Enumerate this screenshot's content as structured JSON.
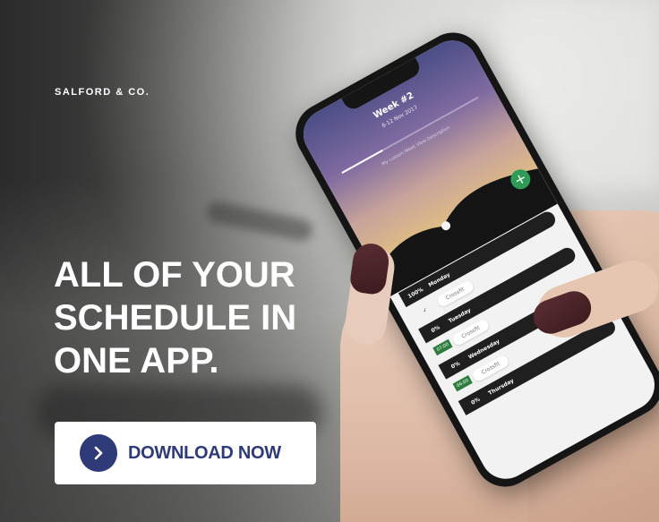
{
  "brand": "SALFORD & CO.",
  "headline": {
    "line1": "ALL OF YOUR",
    "line2": "SCHEDULE IN",
    "line3": "ONE APP."
  },
  "cta": {
    "label": "DOWNLOAD NOW",
    "icon": "chevron-right-icon"
  },
  "phone_screen": {
    "title": "Week #2",
    "date_range": "6-12 Nov 2017",
    "description": "My custom Week View Description",
    "days": [
      {
        "percent": "100%",
        "day": "Monday",
        "check": "✓",
        "time": "",
        "activity": "Crossfit"
      },
      {
        "percent": "0%",
        "day": "Tuesday",
        "check": "",
        "time": "07:00",
        "activity": "Crossfit"
      },
      {
        "percent": "0%",
        "day": "Wednesday",
        "check": "",
        "time": "06:00",
        "activity": "Crossfit"
      },
      {
        "percent": "0%",
        "day": "Thursday",
        "check": "",
        "time": "",
        "activity": ""
      }
    ]
  },
  "colors": {
    "accent": "#2f3a78",
    "button_bg": "#ffffff",
    "add_button": "#2e9b56"
  }
}
